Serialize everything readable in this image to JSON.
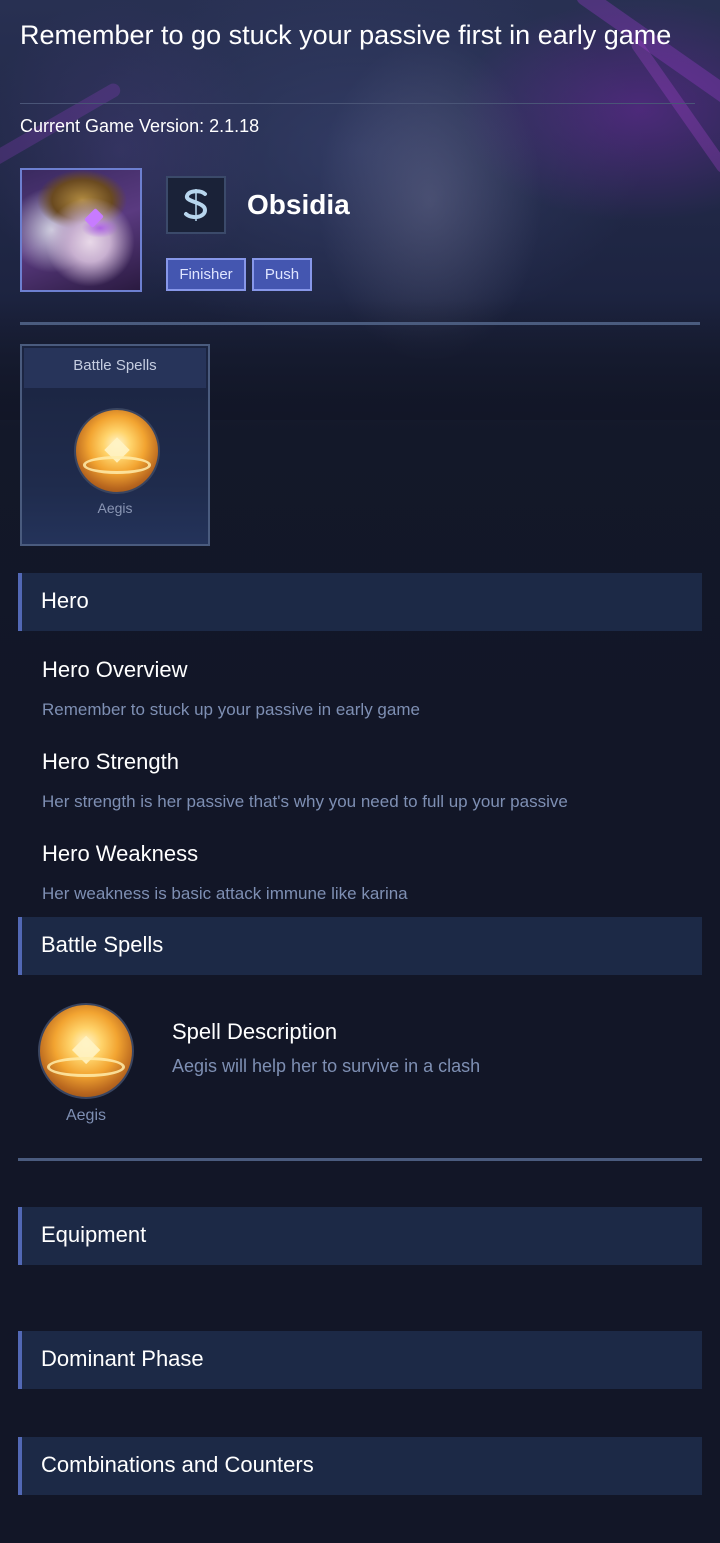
{
  "page": {
    "title": "Remember to go stuck your passive first in early game",
    "version_label": "Current Game Version:",
    "version_value": "2.1.18"
  },
  "hero": {
    "name": "Obsidia",
    "role_icon": "assassin-s-icon",
    "tags": [
      "Finisher",
      "Push"
    ]
  },
  "spells_card": {
    "header": "Battle Spells",
    "spell_name": "Aegis",
    "spell_icon": "aegis-orb-icon"
  },
  "sections": {
    "hero": "Hero",
    "battle_spells": "Battle Spells",
    "equipment": "Equipment",
    "dominant_phase": "Dominant Phase",
    "combinations": "Combinations and Counters"
  },
  "hero_info": [
    {
      "title": "Hero Overview",
      "text": "Remember to stuck up your passive in early game"
    },
    {
      "title": "Hero Strength",
      "text": "Her strength is her passive that's why you need to full up your passive"
    },
    {
      "title": "Hero Weakness",
      "text": "Her weakness is basic attack immune like karina"
    }
  ],
  "spell_detail": {
    "name": "Aegis",
    "title": "Spell Description",
    "text": "Aegis will help her to survive in a clash"
  },
  "colors": {
    "background": "#121627",
    "section_bg": "#1c2946",
    "section_accent": "#5268b5",
    "tag_bg": "#4456b0",
    "muted_text": "#7e8fb3"
  }
}
